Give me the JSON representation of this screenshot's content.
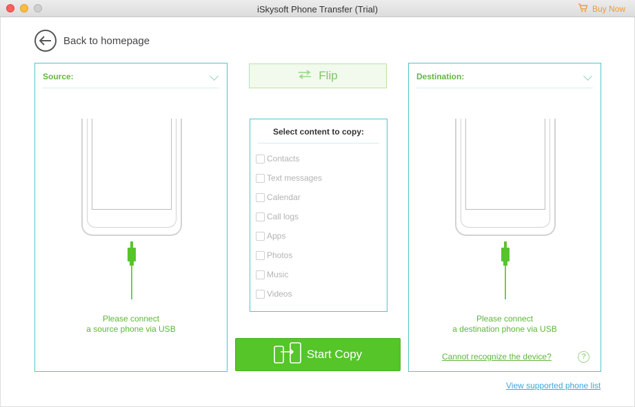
{
  "window": {
    "title": "iSkysoft Phone Transfer (Trial)",
    "buy_now": "Buy Now"
  },
  "nav": {
    "back_label": "Back to homepage"
  },
  "source": {
    "title": "Source:",
    "message_line1": "Please connect",
    "message_line2": "a source phone via USB"
  },
  "destination": {
    "title": "Destination:",
    "message_line1": "Please connect",
    "message_line2": "a destination phone via USB",
    "cannot_recognize": "Cannot recognize the device?",
    "help": "?"
  },
  "flip": {
    "label": "Flip"
  },
  "content": {
    "title": "Select content to copy:",
    "options": [
      {
        "label": "Contacts",
        "checked": false
      },
      {
        "label": "Text messages",
        "checked": false
      },
      {
        "label": "Calendar",
        "checked": false
      },
      {
        "label": "Call logs",
        "checked": false
      },
      {
        "label": "Apps",
        "checked": false
      },
      {
        "label": "Photos",
        "checked": false
      },
      {
        "label": "Music",
        "checked": false
      },
      {
        "label": "Videos",
        "checked": false
      }
    ]
  },
  "start_copy": {
    "label": "Start Copy"
  },
  "footer": {
    "view_supported": "View supported phone list"
  },
  "colors": {
    "accent_green": "#55c52a",
    "text_green": "#5cb53b",
    "panel_border": "#4fc4c9",
    "buy_orange": "#f39a2c",
    "link_blue": "#3aa6d8"
  }
}
